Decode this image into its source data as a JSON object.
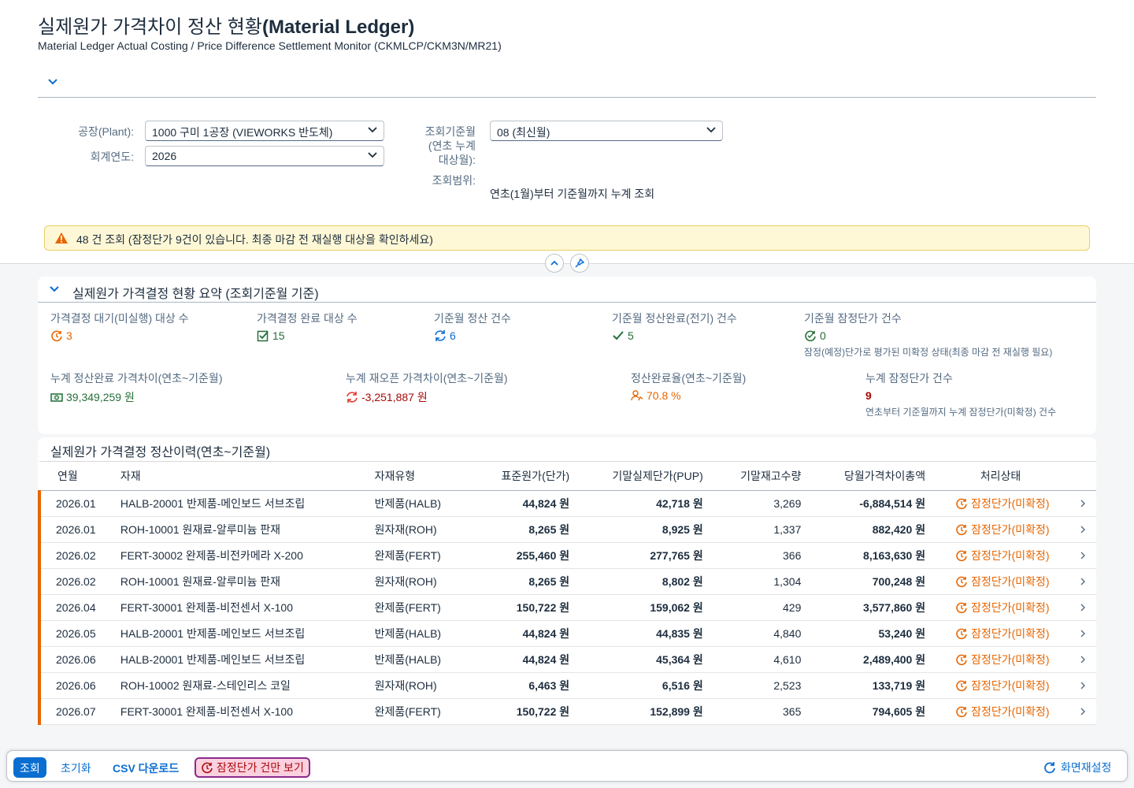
{
  "page": {
    "title_ko": "실제원가 가격차이 정산 현황",
    "title_en": "(Material Ledger)",
    "subtitle": "Material Ledger Actual Costing / Price Difference Settlement Monitor (CKMLCP/CKM3N/MR21)"
  },
  "filters": {
    "plant_label": "공장(Plant):",
    "plant_value": "1000 구미 1공장 (VIEWORKS 반도체)",
    "year_label": "회계연도:",
    "year_value": "2026",
    "month_label_1": "조회기준월",
    "month_label_2": "(연초 누계",
    "month_label_3": "대상월):",
    "month_value": "08 (최신월)",
    "range_label": "조회범위:",
    "range_value": "연초(1월)부터 기준월까지 누계 조회"
  },
  "message": {
    "text": "48 건 조회 (잠정단가 9건이 있습니다. 최종 마감 전 재실행 대상을 확인하세요)",
    "icon": "warning-icon"
  },
  "summary": {
    "title": "실제원가 가격결정 현황 요약 (조회기준월 기준)",
    "kpis": [
      {
        "label": "가격결정 대기(미실행) 대상 수",
        "value": "3",
        "icon": "pending-icon",
        "color": "#e76500"
      },
      {
        "label": "가격결정 완료 대상 수",
        "value": "15",
        "icon": "checkbox-icon",
        "color": "#256f3a"
      },
      {
        "label": "기준월 정산 건수",
        "value": "6",
        "icon": "sync-icon",
        "color": "#0a6ed1"
      },
      {
        "label": "기준월 정산완료(전기) 건수",
        "value": "5",
        "icon": "check-icon",
        "color": "#256f3a"
      },
      {
        "label": "기준월 잠정단가 건수",
        "value": "0",
        "icon": "provisional-icon",
        "color": "#256f3a",
        "desc": "잠정(예정)단가로 평가된 미확정 상태(최종 마감 전 재실행 필요)"
      }
    ],
    "kpis2": [
      {
        "label": "누계 정산완료 가격차이(연초~기준월)",
        "value": "39,349,259 원",
        "icon": "money-icon",
        "color": "#256f3a"
      },
      {
        "label": "누계 재오픈 가격차이(연초~기준월)",
        "value": "-3,251,887 원",
        "icon": "reopen-icon",
        "color": "#aa0808"
      },
      {
        "label": "정산완료율(연초~기준월)",
        "value": "70.8 %",
        "icon": "rate-icon",
        "color": "#e76500"
      },
      {
        "label": "누계 잠정단가 건수",
        "value": "9",
        "color": "#aa0808",
        "desc": "연초부터 기준월까지 누계 잠정단가(미확정) 건수"
      }
    ]
  },
  "history": {
    "title": "실제원가 가격결정 정산이력(연초~기준월)",
    "columns": [
      "연월",
      "자재",
      "자재유형",
      "표준원가(단가)",
      "기말실제단가(PUP)",
      "기말재고수량",
      "당월가격차이총액",
      "처리상태"
    ],
    "rows": [
      {
        "ym": "2026.01",
        "material": "HALB-20001 반제품-메인보드 서브조립",
        "type": "반제품(HALB)",
        "std": "44,824 원",
        "pup": "42,718 원",
        "qty": "3,269",
        "diff": "-6,884,514 원",
        "status": "잠정단가(미확정)"
      },
      {
        "ym": "2026.01",
        "material": "ROH-10001 원재료-알루미늄 판재",
        "type": "원자재(ROH)",
        "std": "8,265 원",
        "pup": "8,925 원",
        "qty": "1,337",
        "diff": "882,420 원",
        "status": "잠정단가(미확정)"
      },
      {
        "ym": "2026.02",
        "material": "FERT-30002 완제품-비전카메라 X-200",
        "type": "완제품(FERT)",
        "std": "255,460 원",
        "pup": "277,765 원",
        "qty": "366",
        "diff": "8,163,630 원",
        "status": "잠정단가(미확정)"
      },
      {
        "ym": "2026.02",
        "material": "ROH-10001 원재료-알루미늄 판재",
        "type": "원자재(ROH)",
        "std": "8,265 원",
        "pup": "8,802 원",
        "qty": "1,304",
        "diff": "700,248 원",
        "status": "잠정단가(미확정)"
      },
      {
        "ym": "2026.04",
        "material": "FERT-30001 완제품-비전센서 X-100",
        "type": "완제품(FERT)",
        "std": "150,722 원",
        "pup": "159,062 원",
        "qty": "429",
        "diff": "3,577,860 원",
        "status": "잠정단가(미확정)"
      },
      {
        "ym": "2026.05",
        "material": "HALB-20001 반제품-메인보드 서브조립",
        "type": "반제품(HALB)",
        "std": "44,824 원",
        "pup": "44,835 원",
        "qty": "4,840",
        "diff": "53,240 원",
        "status": "잠정단가(미확정)"
      },
      {
        "ym": "2026.06",
        "material": "HALB-20001 반제품-메인보드 서브조립",
        "type": "반제품(HALB)",
        "std": "44,824 원",
        "pup": "45,364 원",
        "qty": "4,610",
        "diff": "2,489,400 원",
        "status": "잠정단가(미확정)"
      },
      {
        "ym": "2026.06",
        "material": "ROH-10002 원재료-스테인리스 코일",
        "type": "원자재(ROH)",
        "std": "6,463 원",
        "pup": "6,516 원",
        "qty": "2,523",
        "diff": "133,719 원",
        "status": "잠정단가(미확정)"
      },
      {
        "ym": "2026.07",
        "material": "FERT-30001 완제품-비전센서 X-100",
        "type": "완제품(FERT)",
        "std": "150,722 원",
        "pup": "152,899 원",
        "qty": "365",
        "diff": "794,605 원",
        "status": "잠정단가(미확정)"
      }
    ]
  },
  "footer": {
    "search": "조회",
    "reset": "초기화",
    "csv": "CSV 다운로드",
    "provisional_only": "잠정단가 건만 보기",
    "screen_reset": "화면재설정"
  },
  "colors": {
    "accent": "#0a6ed1",
    "warning": "#e76500",
    "success": "#256f3a",
    "error": "#aa0808"
  }
}
